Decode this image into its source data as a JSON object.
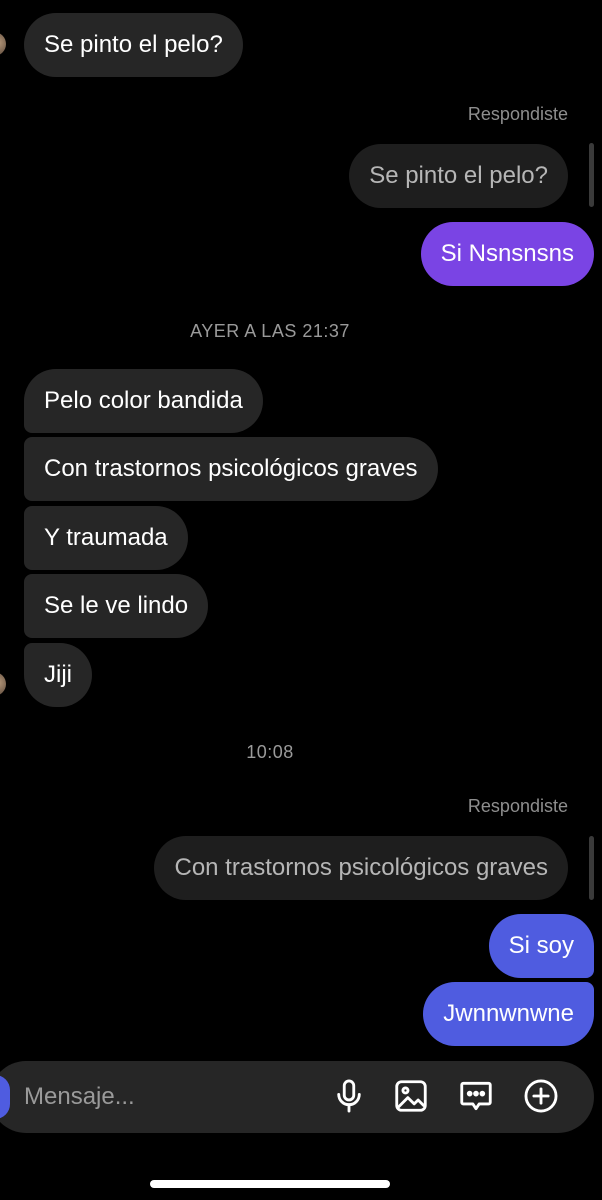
{
  "messages": [
    {
      "id": "m1",
      "text": "Se pinto el pelo?"
    },
    {
      "reply_label": "Respondiste",
      "quoted": "Se pinto el pelo?",
      "text": "Si Nsnsnsns"
    },
    {
      "timestamp": "AYER A LAS 21:37"
    },
    {
      "text": "Pelo color bandida"
    },
    {
      "text": "Con trastornos psicológicos graves"
    },
    {
      "text": "Y traumada"
    },
    {
      "text": "Se le ve lindo"
    },
    {
      "text": "Jiji"
    },
    {
      "timestamp": "10:08"
    },
    {
      "reply_label": "Respondiste",
      "quoted": "Con trastornos psicológicos graves",
      "text": "Si soy"
    },
    {
      "text": "Jwnnwnwne"
    }
  ],
  "composer": {
    "placeholder": "Mensaje...",
    "icons": [
      "microphone-icon",
      "image-icon",
      "sticker-chat-icon",
      "plus-circle-icon"
    ]
  },
  "colors": {
    "background": "#000000",
    "received_bubble": "#262626",
    "sent_purple": "#7a44e4",
    "sent_blue": "#4f5ce0",
    "quoted_bubble": "#1e1e1e"
  }
}
